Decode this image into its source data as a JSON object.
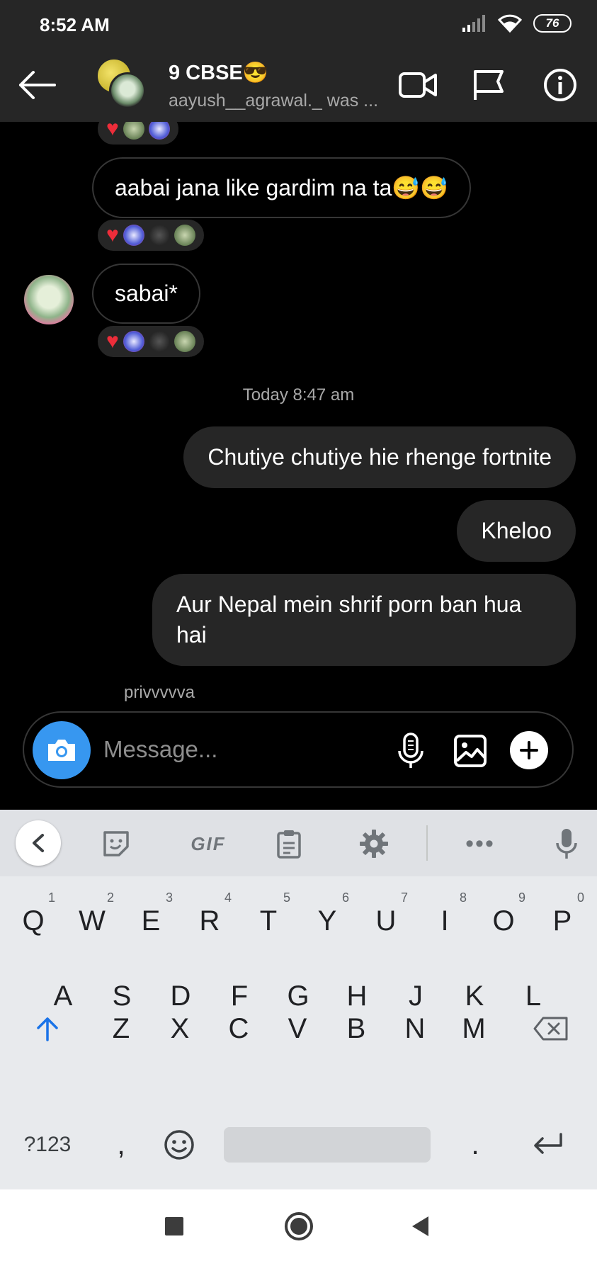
{
  "status_bar": {
    "time": "8:52 AM",
    "battery": "76"
  },
  "header": {
    "group_name": "9 CBSE😎",
    "subtitle": "aayush__agrawal._ was ..."
  },
  "messages": [
    {
      "type": "in",
      "text": "aabai jana like gardim na ta😅😅"
    },
    {
      "type": "in",
      "text": "sabai*"
    },
    {
      "type": "timestamp",
      "text": "Today 8:47 am"
    },
    {
      "type": "out",
      "text": "Chutiye chutiye hie rhenge fortnite"
    },
    {
      "type": "out",
      "text": "Kheloo"
    },
    {
      "type": "out",
      "text": "Aur Nepal mein shrif porn ban hua hai"
    }
  ],
  "typing_text": "privvvvva",
  "composer": {
    "placeholder": "Message..."
  },
  "keyboard": {
    "toolbar": {
      "gif_label": "GIF",
      "more_label": "•••"
    },
    "row1": [
      {
        "key": "Q",
        "hint": "1"
      },
      {
        "key": "W",
        "hint": "2"
      },
      {
        "key": "E",
        "hint": "3"
      },
      {
        "key": "R",
        "hint": "4"
      },
      {
        "key": "T",
        "hint": "5"
      },
      {
        "key": "Y",
        "hint": "6"
      },
      {
        "key": "U",
        "hint": "7"
      },
      {
        "key": "I",
        "hint": "8"
      },
      {
        "key": "O",
        "hint": "9"
      },
      {
        "key": "P",
        "hint": "0"
      }
    ],
    "row2": [
      "A",
      "S",
      "D",
      "F",
      "G",
      "H",
      "J",
      "K",
      "L"
    ],
    "row3": [
      "Z",
      "X",
      "C",
      "V",
      "B",
      "N",
      "M"
    ],
    "symbols_label": "?123",
    "comma_label": ",",
    "period_label": "."
  },
  "colors": {
    "accent": "#3797f0",
    "heart": "#ed2d3a",
    "header_bg": "#262626",
    "keyboard_bg": "#e8eaed"
  }
}
